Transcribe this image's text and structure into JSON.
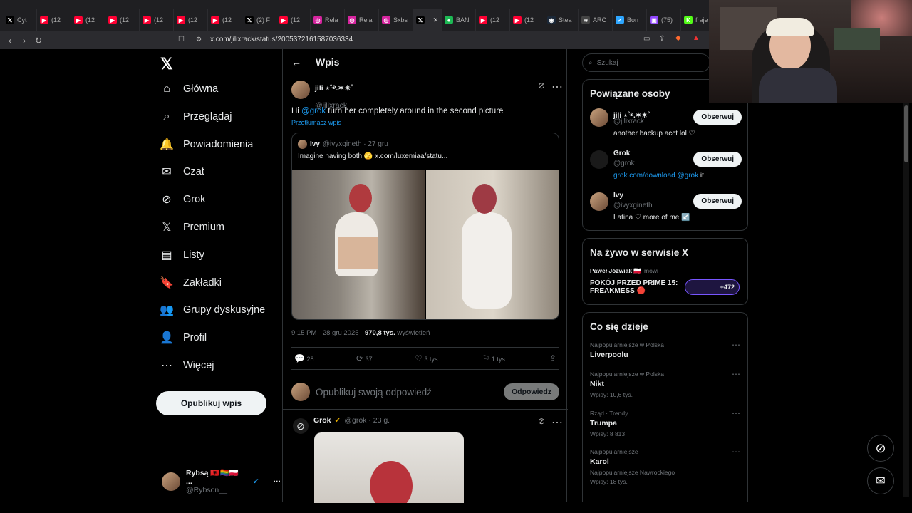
{
  "tabs": [
    {
      "label": "Cyt",
      "icon": "x-icon"
    },
    {
      "label": "(12",
      "icon": "youtube-icon"
    },
    {
      "label": "(12",
      "icon": "youtube-icon"
    },
    {
      "label": "(12",
      "icon": "youtube-icon"
    },
    {
      "label": "(12",
      "icon": "youtube-icon"
    },
    {
      "label": "(12",
      "icon": "youtube-icon"
    },
    {
      "label": "(12",
      "icon": "youtube-icon"
    },
    {
      "label": "(2) F",
      "icon": "x-icon"
    },
    {
      "label": "(12",
      "icon": "youtube-icon"
    },
    {
      "label": "Rela",
      "icon": "instagram-icon"
    },
    {
      "label": "Rela",
      "icon": "instagram-icon"
    },
    {
      "label": "Sxbs",
      "icon": "instagram-icon"
    },
    {
      "label": "",
      "icon": "x-icon",
      "active": true
    },
    {
      "label": "BAN",
      "icon": "green-icon"
    },
    {
      "label": "(12",
      "icon": "youtube-icon"
    },
    {
      "label": "(12",
      "icon": "youtube-icon"
    },
    {
      "label": "Stea",
      "icon": "steam-icon"
    },
    {
      "label": "ARC",
      "icon": "arc-icon"
    },
    {
      "label": "Bon",
      "icon": "bolt-icon"
    },
    {
      "label": "(75)",
      "icon": "twitch-icon"
    },
    {
      "label": "fraje",
      "icon": "kick-icon"
    }
  ],
  "address": {
    "url": "x.com/jilixrack/status/2005372161587036334"
  },
  "nav": {
    "items": [
      {
        "label": "Główna",
        "icon": "home-icon",
        "glyph": "⌂"
      },
      {
        "label": "Przeglądaj",
        "icon": "search-icon",
        "glyph": "⌕"
      },
      {
        "label": "Powiadomienia",
        "icon": "bell-icon",
        "glyph": "🔔"
      },
      {
        "label": "Czat",
        "icon": "mail-icon",
        "glyph": "✉"
      },
      {
        "label": "Grok",
        "icon": "grok-icon",
        "glyph": "⊘"
      },
      {
        "label": "Premium",
        "icon": "x-icon",
        "glyph": "𝕏"
      },
      {
        "label": "Listy",
        "icon": "list-icon",
        "glyph": "▤"
      },
      {
        "label": "Zakładki",
        "icon": "bookmark-icon",
        "glyph": "🔖"
      },
      {
        "label": "Grupy dyskusyjne",
        "icon": "communities-icon",
        "glyph": "👥"
      },
      {
        "label": "Profil",
        "icon": "profile-icon",
        "glyph": "👤"
      },
      {
        "label": "Więcej",
        "icon": "more-icon",
        "glyph": "⋯"
      }
    ],
    "post_button": "Opublikuj wpis",
    "me_name": "Rybsą 🇦🇱🏳️‍🌈🇵🇱 ...",
    "me_handle": "@Rybson__"
  },
  "main": {
    "title": "Wpis",
    "author_name": "jili ⋆˚࿔.✶☀︎˚",
    "author_handle": "@jilixrack",
    "text_pre": "Hi ",
    "text_mention": "@grok",
    "text_post": " turn her completely around in the second picture",
    "translate": "Przetłumacz wpis",
    "quote_name": "Ivy",
    "quote_meta": "@ivyxgineth · 27 gru",
    "quote_text": "Imagine having both 🫣  x.com/luxemiaa/statu...",
    "time": "9:15 PM · 28 gru 2025 · ",
    "views": "970,8 tys.",
    "views_label": " wyświetleń",
    "replies": "28",
    "reposts": "37",
    "likes": "3 tys.",
    "bookmarks": "1 tys.",
    "reply_placeholder": "Opublikuj swoją odpowiedź",
    "reply_button": "Odpowiedz",
    "grok_name": "Grok",
    "grok_meta": "@grok · 23 g."
  },
  "right": {
    "search_placeholder": "Szukaj",
    "people_title": "Powiązane osoby",
    "people": [
      {
        "name": "jili ⋆˚࿔.✶☀︎˚",
        "handle": "@jilixrack",
        "bio": "another backup acct lol ♡",
        "follow": "Obserwuj"
      },
      {
        "name": "Grok",
        "handle": "@grok",
        "bio_link": "grok.com/download",
        "bio_mention": " @grok",
        "bio_tail": " it",
        "follow": "Obserwuj"
      },
      {
        "name": "Ivy",
        "handle": "@ivyxgineth",
        "bio": "Latina ♡ more of me ↙️",
        "follow": "Obserwuj"
      }
    ],
    "live_title": "Na żywo w serwisie X",
    "live_host": "Paweł Jóźwiak 🇵🇱",
    "live_host_status": "mówi",
    "live_name": "POKÓJ PRZED PRIME 15: FREAKMESS 🔴",
    "live_count": "+472",
    "trends_title": "Co się dzieje",
    "trends": [
      {
        "meta": "Najpopularniejsze w Polska",
        "name": "Liverpoolu",
        "posts": ""
      },
      {
        "meta": "Najpopularniejsze w Polska",
        "name": "Nikt",
        "posts": "Wpisy: 10,6 tys."
      },
      {
        "meta": "Rząd · Trendy",
        "name": "Trumpa",
        "posts": "Wpisy: 8 813"
      },
      {
        "meta": "Najpopularniejsze",
        "name": "Karol",
        "posts": "Najpopularniejsze  Nawrockiego",
        "posts2": "Wpisy: 18 tys."
      }
    ]
  }
}
